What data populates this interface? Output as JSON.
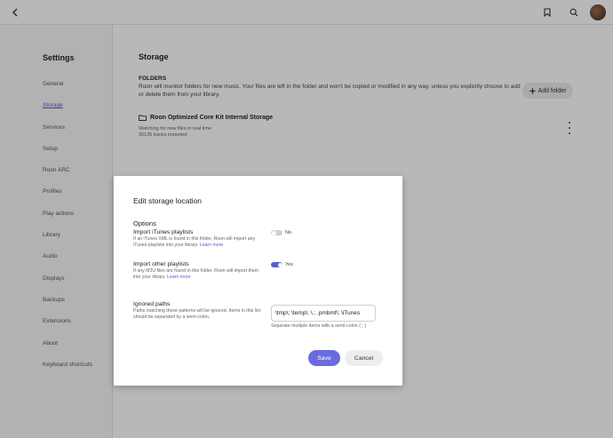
{
  "topbar": {
    "back_icon": "chevron-left-icon",
    "bookmark_icon": "bookmark-icon",
    "search_icon": "search-icon"
  },
  "sidebar": {
    "title": "Settings",
    "items": [
      {
        "label": "General",
        "active": false
      },
      {
        "label": "Storage",
        "active": true
      },
      {
        "label": "Services",
        "active": false
      },
      {
        "label": "Setup",
        "active": false
      },
      {
        "label": "Roon ARC",
        "active": false
      },
      {
        "label": "Profiles",
        "active": false
      },
      {
        "label": "Play actions",
        "active": false
      },
      {
        "label": "Library",
        "active": false
      },
      {
        "label": "Audio",
        "active": false
      },
      {
        "label": "Displays",
        "active": false
      },
      {
        "label": "Backups",
        "active": false
      },
      {
        "label": "Extensions",
        "active": false
      },
      {
        "label": "About",
        "active": false
      },
      {
        "label": "Keyboard shortcuts",
        "active": false
      }
    ]
  },
  "main": {
    "title": "Storage",
    "folders_title": "FOLDERS",
    "folders_desc": "Roon will monitor folders for new music. Your files are left in the folder and won't be copied or modified in any way, unless you explicitly choose to add or delete them from your library.",
    "add_folder_label": "Add folder",
    "storage_name": "Roon Optimized Core Kit Internal Storage",
    "storage_status": "Watching for new files in real time",
    "storage_tracks": "30136 tracks imported"
  },
  "dialog": {
    "title": "Edit storage location",
    "options_title": "Options",
    "itunes": {
      "label": "Import iTunes playlists",
      "desc": "If an iTunes XML is found in this folder, Roon will import any iTunes playlists into your library.",
      "learn_more": "Learn more",
      "toggle_text": "No",
      "enabled": false
    },
    "other": {
      "label": "Import other playlists",
      "desc": "If any M3U files are found in this folder, Roon will import them into your library.",
      "learn_more": "Learn more",
      "toggle_text": "Yes",
      "enabled": true
    },
    "ignored": {
      "label": "Ignored paths",
      "desc": "Paths matching these patterns will be ignored. Items in this list should be separated by a semi-colon.",
      "value": "\\tmp\\; \\temp\\; \\.; .pmbmf\\; \\iTunes",
      "hint": "Separate multiple items with a semi-colon ( ; )"
    },
    "save_label": "Save",
    "cancel_label": "Cancel"
  },
  "colors": {
    "accent": "#5b5bd6",
    "save_button": "#6b6be0"
  }
}
